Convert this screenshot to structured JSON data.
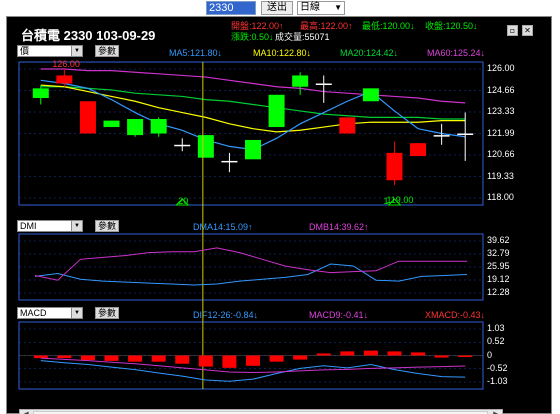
{
  "toolbar": {
    "stock_code": "2330",
    "submit_label": "送出",
    "period": "日線"
  },
  "header": {
    "title": "台積電 2330 103-09-29",
    "open": "開盤:122.00↑",
    "high": "最高:122.00↑",
    "low": "最低:120.00↓",
    "close": "收盤:120.50↓",
    "change": "漲跌:0.50↓",
    "volume": "成交量:55071"
  },
  "main_panel": {
    "indicator_select": "價",
    "param_label": "參數",
    "ma5": "MA5:121.80↓",
    "ma10": "MA10:122.80↓",
    "ma20": "MA20:124.42↓",
    "ma60": "MA60:125.24↓",
    "y_ticks": [
      "126.00",
      "124.66",
      "123.33",
      "121.99",
      "120.66",
      "119.33",
      "118.00"
    ],
    "high_marker": "126.00",
    "low_marker": "119.00",
    "date_marker_left": "20",
    "date_marker_right": "1"
  },
  "dmi_panel": {
    "indicator_select": "DMI",
    "param_label": "參數",
    "dma14": "DMA14:15.09↑",
    "dmb14": "DMB14:39.62↑",
    "y_ticks": [
      "39.62",
      "32.79",
      "25.95",
      "19.12",
      "12.28"
    ]
  },
  "macd_panel": {
    "indicator_select": "MACD",
    "param_label": "參數",
    "dif": "DIF12-26:-0.84↓",
    "macd9": "MACD9:-0.41↓",
    "xmacd": "XMACD:-0.43↓",
    "y_ticks": [
      "1.03",
      "0.52",
      "0",
      "-0.52",
      "-1.03"
    ]
  },
  "colors": {
    "up": "#ff0000",
    "down": "#00ff00",
    "ma5": "#3399ff",
    "ma10": "#ffff00",
    "ma20": "#00cc33",
    "ma60": "#cc33cc",
    "frame": "#2f5fd6"
  },
  "chart_data": [
    {
      "type": "candlestick",
      "title": "台積電 2330",
      "ylim": [
        118.0,
        126.0
      ],
      "candles": [
        {
          "open": 124.8,
          "close": 124.2,
          "high": 125.0,
          "low": 123.8
        },
        {
          "open": 125.1,
          "close": 125.6,
          "high": 126.0,
          "low": 124.9
        },
        {
          "open": 122.0,
          "close": 124.0,
          "high": 124.0,
          "low": 122.0
        },
        {
          "open": 122.8,
          "close": 122.4,
          "high": 122.8,
          "low": 122.4
        },
        {
          "open": 122.9,
          "close": 121.9,
          "high": 122.9,
          "low": 121.8
        },
        {
          "open": 122.9,
          "close": 122.0,
          "high": 123.0,
          "low": 121.8
        },
        {
          "open": 121.3,
          "close": 121.3,
          "high": 121.7,
          "low": 120.9
        },
        {
          "open": 121.9,
          "close": 120.5,
          "high": 121.9,
          "low": 120.5
        },
        {
          "open": 120.3,
          "close": 120.3,
          "high": 120.8,
          "low": 119.6
        },
        {
          "open": 121.6,
          "close": 120.4,
          "high": 121.6,
          "low": 120.4
        },
        {
          "open": 124.4,
          "close": 122.4,
          "high": 124.4,
          "low": 122.4
        },
        {
          "open": 125.6,
          "close": 124.9,
          "high": 125.8,
          "low": 124.4
        },
        {
          "open": 125.1,
          "close": 125.1,
          "high": 125.6,
          "low": 123.9
        },
        {
          "open": 122.0,
          "close": 123.0,
          "high": 123.0,
          "low": 122.0
        },
        {
          "open": 124.8,
          "close": 124.0,
          "high": 124.8,
          "low": 124.0
        },
        {
          "open": 119.1,
          "close": 120.8,
          "high": 121.5,
          "low": 118.8
        },
        {
          "open": 120.6,
          "close": 121.4,
          "high": 121.4,
          "low": 120.6
        },
        {
          "open": 121.9,
          "close": 121.9,
          "high": 122.6,
          "low": 121.3
        },
        {
          "open": 122.0,
          "close": 122.0,
          "high": 123.3,
          "low": 120.3
        }
      ],
      "ma5": [
        125.3,
        125.1,
        124.8,
        124.1,
        123.3,
        122.6,
        122.2,
        121.6,
        121.2,
        121.0,
        121.7,
        122.6,
        123.3,
        124.0,
        124.6,
        123.4,
        122.3,
        122.0,
        121.8
      ],
      "ma10": [
        125.0,
        124.9,
        124.6,
        124.3,
        124.0,
        123.6,
        123.3,
        123.0,
        122.6,
        122.3,
        122.1,
        122.2,
        122.4,
        122.6,
        122.7,
        122.7,
        122.7,
        122.8,
        122.8
      ],
      "ma20": [
        124.9,
        124.9,
        124.8,
        124.7,
        124.5,
        124.4,
        124.3,
        124.1,
        124.0,
        123.8,
        123.6,
        123.4,
        123.2,
        123.1,
        123.0,
        123.0,
        123.0,
        122.9,
        122.9
      ],
      "ma60": [
        126.0,
        126.0,
        125.9,
        125.9,
        125.8,
        125.7,
        125.6,
        125.5,
        125.3,
        125.1,
        124.9,
        124.8,
        124.6,
        124.5,
        124.4,
        124.3,
        124.2,
        124.0,
        123.9
      ]
    },
    {
      "type": "line",
      "title": "DMI",
      "ylim": [
        12.28,
        39.62
      ],
      "series": [
        {
          "name": "DMA14",
          "values": [
            21.0,
            22.5,
            19.5,
            18.5,
            18.0,
            17.5,
            17.0,
            16.5,
            17.0,
            18.5,
            19.5,
            20.5,
            22.0,
            27.5,
            26.5,
            19.0,
            18.5,
            21.0,
            21.5,
            22.0
          ]
        },
        {
          "name": "DMB14",
          "values": [
            21.5,
            19.0,
            30.0,
            31.0,
            32.0,
            33.5,
            34.0,
            34.0,
            36.0,
            33.5,
            30.0,
            26.5,
            24.5,
            23.0,
            23.5,
            24.0,
            29.0,
            29.0,
            29.0,
            29.0
          ]
        }
      ]
    },
    {
      "type": "bar",
      "title": "MACD",
      "ylim": [
        -1.03,
        1.03
      ],
      "xmacd": [
        -0.1,
        -0.1,
        -0.18,
        -0.21,
        -0.24,
        -0.24,
        -0.32,
        -0.43,
        -0.48,
        -0.4,
        -0.24,
        -0.16,
        0.08,
        0.16,
        0.19,
        0.16,
        0.12,
        -0.08,
        -0.06
      ],
      "series": [
        {
          "name": "DIF12-26",
          "values": [
            -0.2,
            -0.28,
            -0.35,
            -0.45,
            -0.55,
            -0.68,
            -0.8,
            -0.95,
            -1.0,
            -0.92,
            -0.7,
            -0.5,
            -0.4,
            -0.48,
            -0.35,
            -0.55,
            -0.7,
            -0.82,
            -0.84
          ]
        },
        {
          "name": "MACD9",
          "values": [
            -0.1,
            -0.15,
            -0.2,
            -0.26,
            -0.32,
            -0.4,
            -0.48,
            -0.56,
            -0.64,
            -0.66,
            -0.64,
            -0.6,
            -0.56,
            -0.54,
            -0.5,
            -0.48,
            -0.45,
            -0.43,
            -0.41
          ]
        }
      ]
    }
  ]
}
